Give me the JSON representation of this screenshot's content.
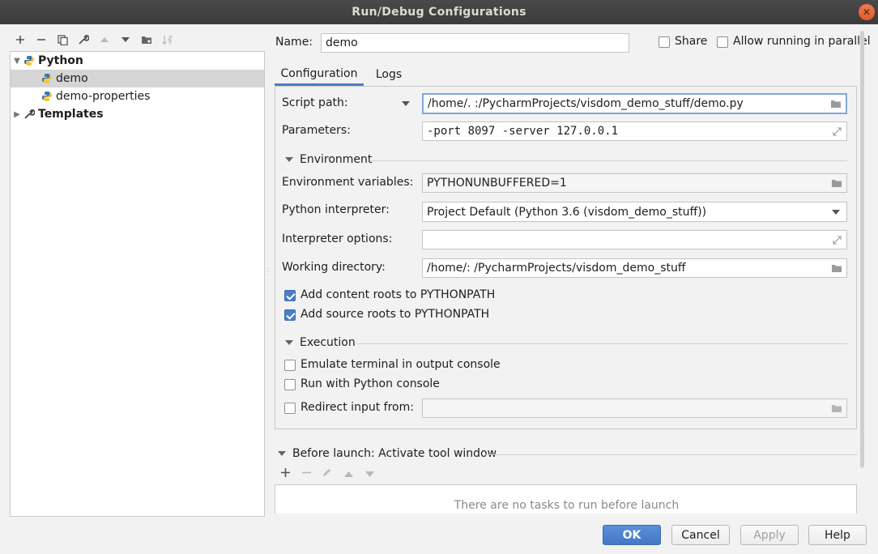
{
  "window": {
    "title": "Run/Debug Configurations"
  },
  "tree": {
    "items": [
      {
        "label": "Python",
        "bold": true
      },
      {
        "label": "demo"
      },
      {
        "label": "demo-properties"
      },
      {
        "label": "Templates",
        "bold": true
      }
    ]
  },
  "header": {
    "name_label": "Name:",
    "name_value": "demo",
    "share_label": "Share",
    "parallel_label": "Allow running in parallel"
  },
  "tabs": [
    {
      "label": "Configuration"
    },
    {
      "label": "Logs"
    }
  ],
  "config": {
    "script_path_label": "Script path:",
    "script_path_value": "/home/.           :/PycharmProjects/visdom_demo_stuff/demo.py",
    "parameters_label": "Parameters:",
    "parameters_value": "-port 8097 -server 127.0.0.1",
    "environment_header": "Environment",
    "env_vars_label": "Environment variables:",
    "env_vars_value": "PYTHONUNBUFFERED=1",
    "interpreter_label": "Python interpreter:",
    "interpreter_value": "Project Default (Python 3.6 (visdom_demo_stuff))",
    "interp_options_label": "Interpreter options:",
    "interp_options_value": "",
    "workdir_label": "Working directory:",
    "workdir_value": "/home/:           /PycharmProjects/visdom_demo_stuff",
    "content_roots_label": "Add content roots to PYTHONPATH",
    "content_roots_checked": true,
    "source_roots_label": "Add source roots to PYTHONPATH",
    "source_roots_checked": true,
    "execution_header": "Execution",
    "emulate_label": "Emulate terminal in output console",
    "emulate_checked": false,
    "python_console_label": "Run with Python console",
    "python_console_checked": false,
    "redirect_label": "Redirect input from:",
    "redirect_checked": false,
    "redirect_value": ""
  },
  "before_launch": {
    "header": "Before launch: Activate tool window",
    "empty_text": "There are no tasks to run before launch"
  },
  "buttons": {
    "ok": "OK",
    "cancel": "Cancel",
    "apply": "Apply",
    "help": "Help"
  },
  "colors": {
    "accent": "#4a7ec7",
    "titlebar": "#3b3b3b",
    "close": "#e05a28"
  }
}
